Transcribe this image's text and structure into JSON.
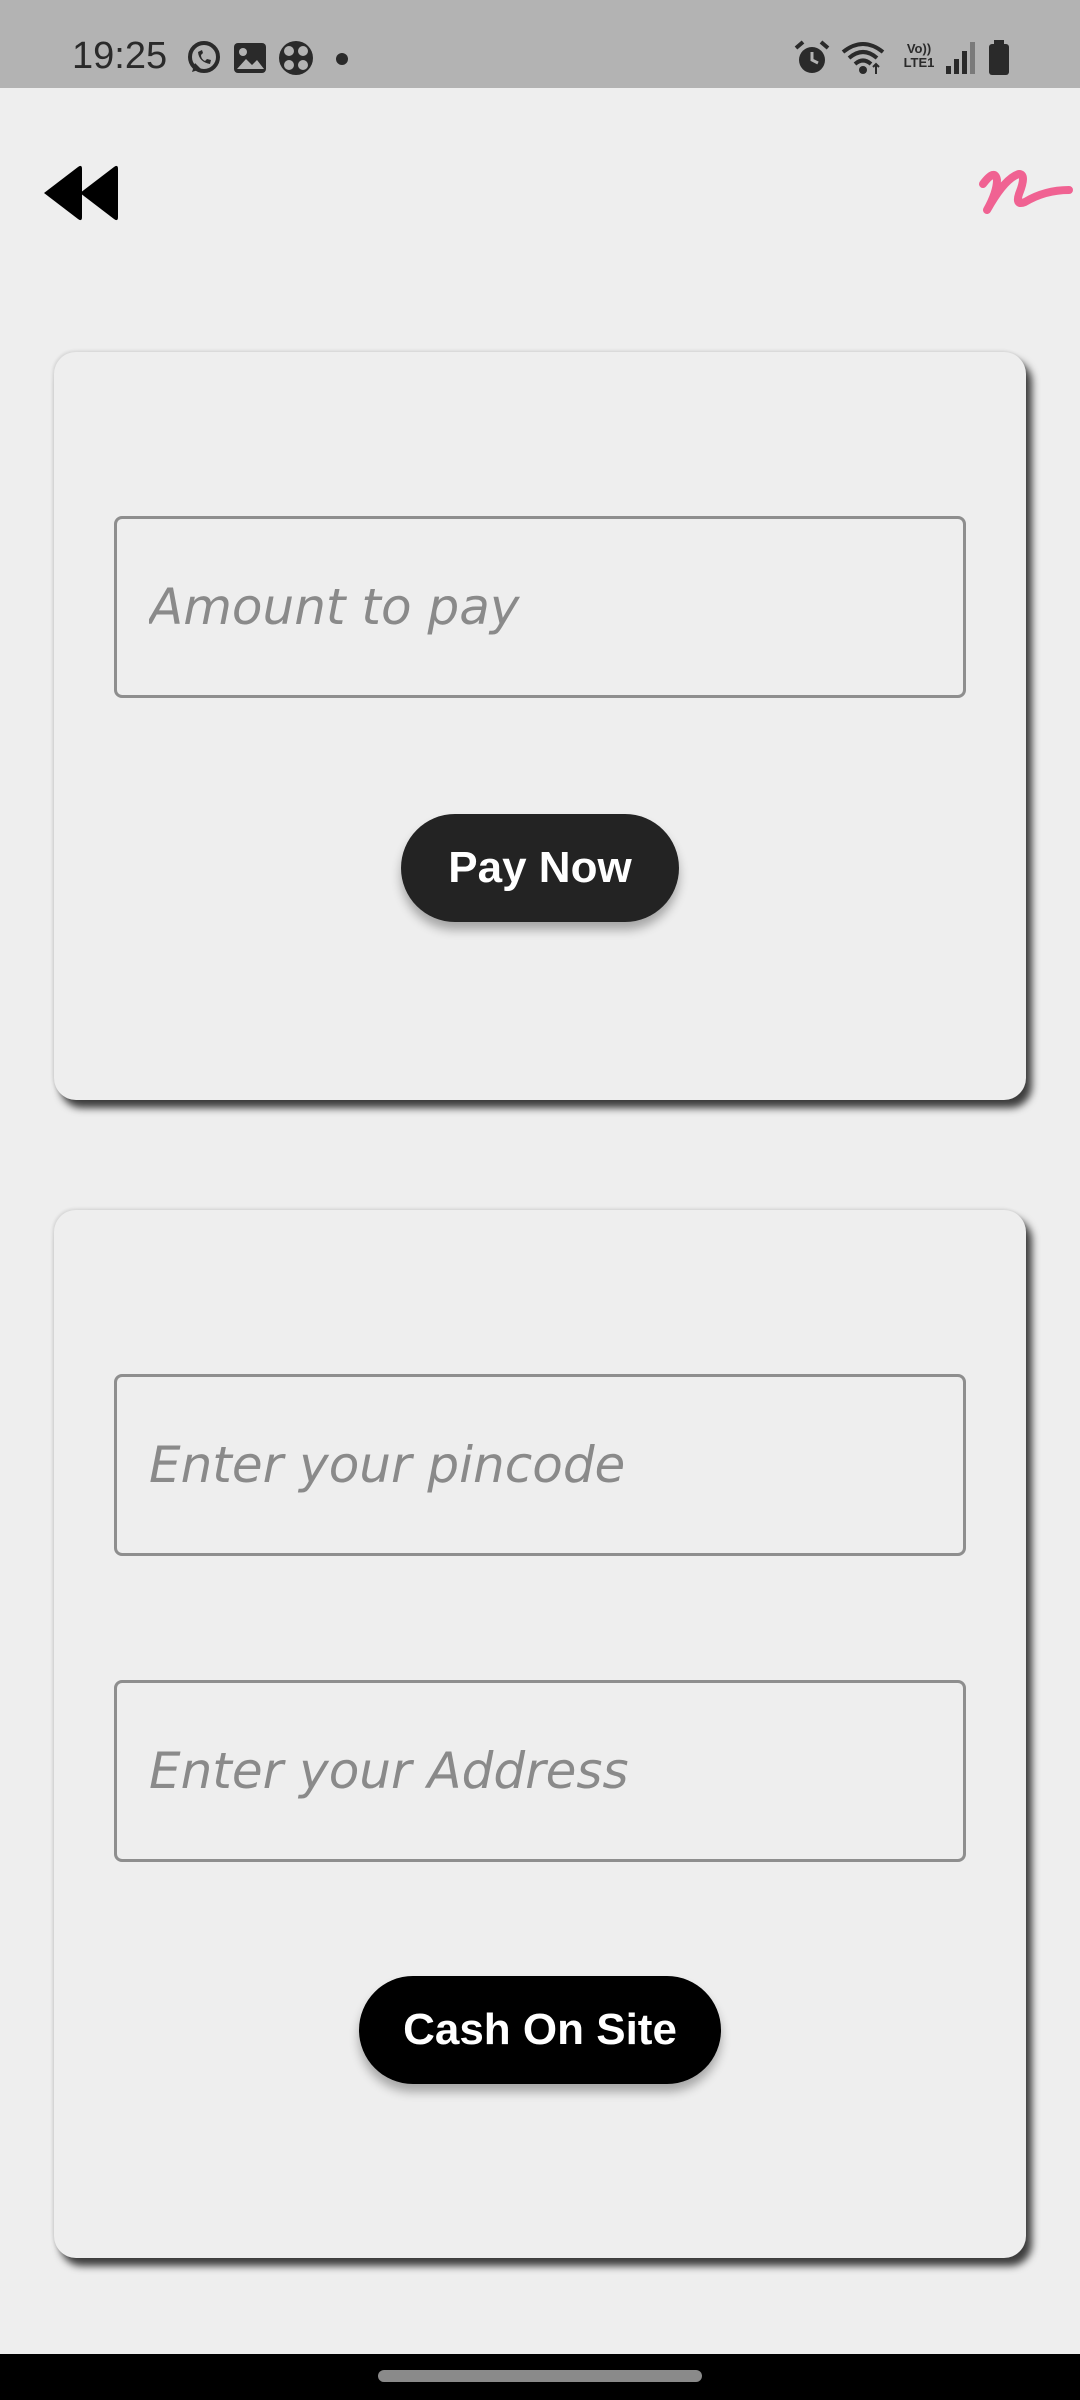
{
  "status_bar": {
    "time": "19:25",
    "network_label": "Vo))\nLTE1",
    "left_icons": [
      "whatsapp-icon",
      "gallery-icon",
      "app-icon",
      "dot-icon"
    ],
    "right_icons": [
      "alarm-icon",
      "wifi-icon",
      "volte-icon",
      "signal-icon",
      "battery-icon"
    ]
  },
  "app_bar": {
    "back_icon": "rewind-back-icon",
    "logo_icon": "brand-logo-icon",
    "logo_color": "#f06292"
  },
  "payment_card": {
    "amount_placeholder": "Amount to pay",
    "amount_value": "",
    "pay_now_label": "Pay Now"
  },
  "cod_card": {
    "pincode_placeholder": "Enter your pincode",
    "pincode_value": "",
    "address_placeholder": "Enter your Address",
    "address_value": "",
    "cash_on_site_label": "Cash On Site"
  },
  "colors": {
    "background": "#eeeeee",
    "button_dark": "#232323",
    "button_black": "#000000",
    "accent": "#f06292"
  }
}
